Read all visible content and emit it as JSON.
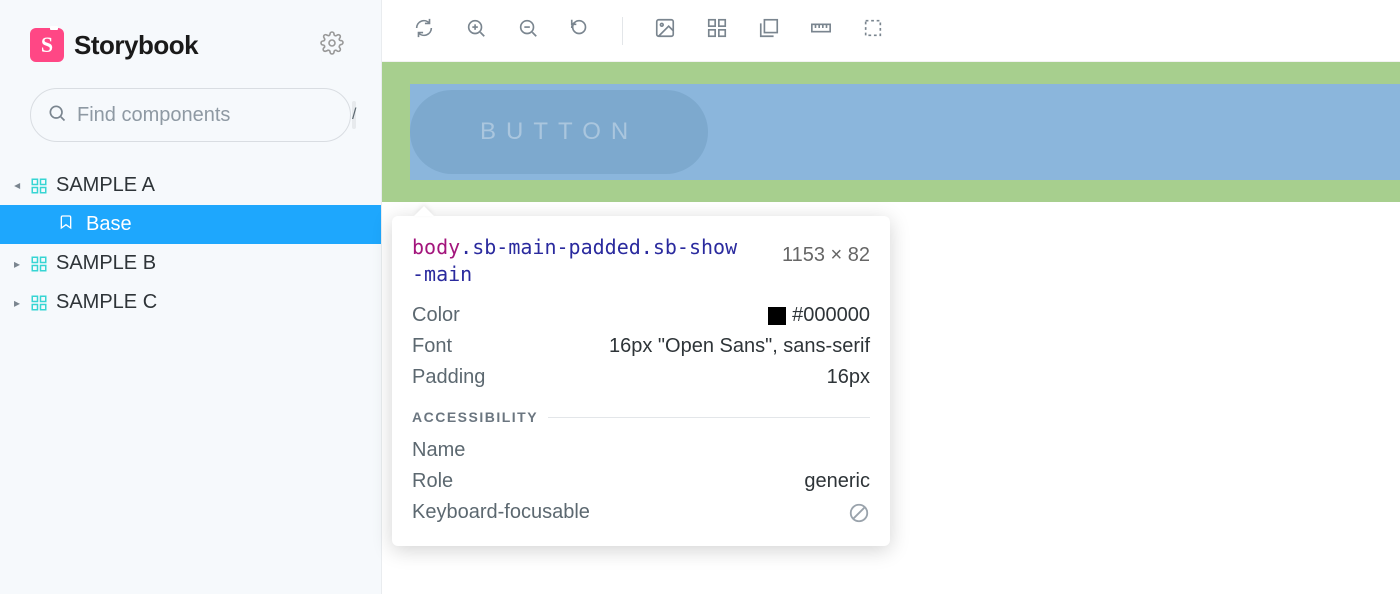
{
  "brand": {
    "logo_letter": "S",
    "title": "Storybook"
  },
  "search": {
    "placeholder": "Find components",
    "shortcut": "/"
  },
  "sidebar": {
    "items": [
      {
        "label": "SAMPLE A",
        "expanded": true,
        "stories": [
          {
            "label": "Base"
          }
        ]
      },
      {
        "label": "SAMPLE B",
        "expanded": false
      },
      {
        "label": "SAMPLE C",
        "expanded": false
      }
    ]
  },
  "canvas": {
    "button_label": "BUTTON"
  },
  "inspector": {
    "selector_tag": "body",
    "selector_classes": ".sb-main-padded.sb-show-main",
    "dimensions": "1153 × 82",
    "rows": {
      "color_label": "Color",
      "color_value": "#000000",
      "font_label": "Font",
      "font_value": "16px \"Open Sans\", sans-serif",
      "padding_label": "Padding",
      "padding_value": "16px"
    },
    "accessibility_heading": "ACCESSIBILITY",
    "a11y": {
      "name_label": "Name",
      "name_value": "",
      "role_label": "Role",
      "role_value": "generic",
      "focusable_label": "Keyboard-focusable"
    }
  }
}
